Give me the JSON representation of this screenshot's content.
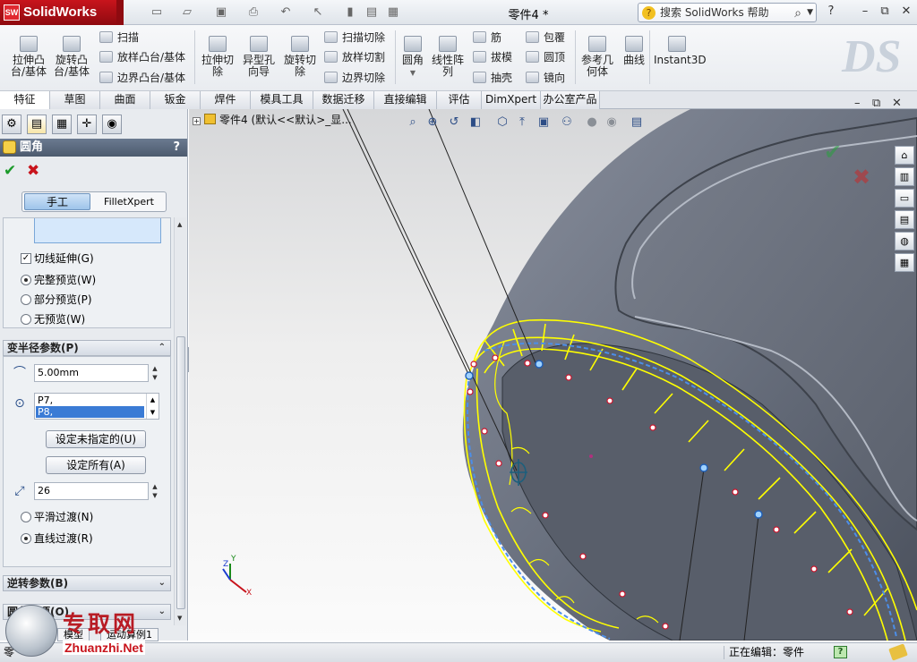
{
  "app": {
    "name": "SolidWorks",
    "badge": "SW",
    "document_title": "零件4 *",
    "help_search": "搜索 SolidWorks 帮助",
    "help_btn": "?",
    "min_btn": "–",
    "restore_btn": "⧉",
    "close_btn": "✕"
  },
  "ribbon": {
    "extrude_boss": "拉伸凸\n台/基体",
    "revolve_boss": "旋转凸\n台/基体",
    "sweep": "扫描",
    "loft": "放样凸台/基体",
    "boundary_boss": "边界凸台/基体",
    "extrude_cut": "拉伸切\n除",
    "hole_wizard": "异型孔\n向导",
    "revolve_cut": "旋转切\n除",
    "sweep_cut": "扫描切除",
    "loft_cut": "放样切割",
    "boundary_cut": "边界切除",
    "fillet": "圆角",
    "linear_pattern": "线性阵\n列",
    "rib": "筋",
    "draft": "拔模",
    "shell": "抽壳",
    "wrap": "包覆",
    "dome": "圆顶",
    "mirror": "镜向",
    "ref_geometry": "参考几\n何体",
    "curves": "曲线",
    "instant3d": "Instant3D",
    "ds_logo": "DS"
  },
  "tabs": [
    "特征",
    "草图",
    "曲面",
    "钣金",
    "焊件",
    "模具工具",
    "数据迁移",
    "直接编辑",
    "评估",
    "DimXpert",
    "办公室产品"
  ],
  "property_manager": {
    "title": "圆角",
    "help": "?",
    "ok": "✔",
    "cancel": "✖",
    "mode_manual": "手工",
    "mode_xpert": "FilletXpert",
    "tangent_propagation": "切线延伸(G)",
    "full_preview": "完整预览(W)",
    "partial_preview": "部分预览(P)",
    "no_preview": "无预览(W)",
    "variable_radius_section": "变半径参数(P)",
    "radius_value": "5.00mm",
    "vertex_items": [
      "P7,",
      "P8,"
    ],
    "set_unassigned": "设定未指定的(U)",
    "set_all": "设定所有(A)",
    "instances": "26",
    "smooth_transition": "平滑过渡(N)",
    "straight_transition": "直线过渡(R)",
    "setback_section": "逆转参数(B)",
    "fillet_options_section": "圆角选项(O)"
  },
  "viewport": {
    "tree_crumb": "零件4 (默认<<默认>_显...",
    "triad_x": "X",
    "triad_y": "Y",
    "triad_z": "Z"
  },
  "bottom_tabs": [
    "模型",
    "运动算例1"
  ],
  "status": {
    "left": "零",
    "editing": "正在编辑：零件",
    "help_icon": "?"
  },
  "watermark": {
    "cn": "专取网",
    "en": "Zhuanzhi.Net"
  },
  "colors": {
    "brand": "#c8141c",
    "selection_yellow": "#ffff00",
    "edge_blue": "#4c8ee8"
  }
}
